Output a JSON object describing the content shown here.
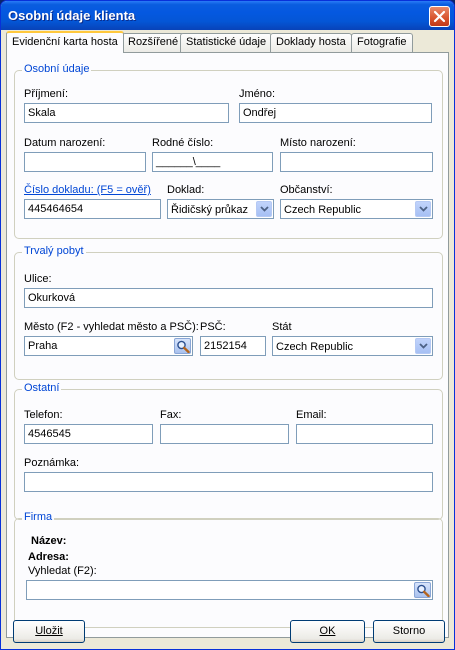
{
  "window": {
    "title": "Osobní údaje klienta"
  },
  "tabs": [
    {
      "label": "Evidenční karta hosta"
    },
    {
      "label": "Rozšířené"
    },
    {
      "label": "Statistické údaje"
    },
    {
      "label": "Doklady hosta"
    },
    {
      "label": "Fotografie"
    }
  ],
  "personal": {
    "legend": "Osobní údaje",
    "surname_label": "Příjmení:",
    "surname_value": "Skala",
    "firstname_label": "Jméno:",
    "firstname_value": "Ondřej",
    "birthdate_label": "Datum narození:",
    "birthdate_value": "",
    "birthnumber_label": "Rodné číslo:",
    "birthnumber_value": "______\\____",
    "birthplace_label": "Místo narození:",
    "birthplace_value": "",
    "docnumber_label": "Číslo dokladu: (F5 = ověř)",
    "docnumber_value": "445464654",
    "doctype_label": "Doklad:",
    "doctype_value": "Řidičský průkaz",
    "citizenship_label": "Občanství:",
    "citizenship_value": "Czech Republic"
  },
  "residence": {
    "legend": "Trvalý pobyt",
    "street_label": "Ulice:",
    "street_value": "Okurková",
    "city_label": "Město (F2 - vyhledat město a PSČ):",
    "city_value": "Praha",
    "zip_label": "PSČ:",
    "zip_value": "2152154",
    "state_label": "Stát",
    "state_value": "Czech Republic"
  },
  "other": {
    "legend": "Ostatní",
    "phone_label": "Telefon:",
    "phone_value": "4546545",
    "fax_label": "Fax:",
    "fax_value": "",
    "email_label": "Email:",
    "email_value": "",
    "note_label": "Poznámka:",
    "note_value": ""
  },
  "company": {
    "legend": "Firma",
    "name_label": "Název:",
    "address_label": "Adresa:",
    "search_label": "Vyhledat (F2):",
    "search_value": ""
  },
  "buttons": {
    "save_label": "Uložit",
    "ok_label": "OK",
    "cancel_label": "Storno"
  }
}
